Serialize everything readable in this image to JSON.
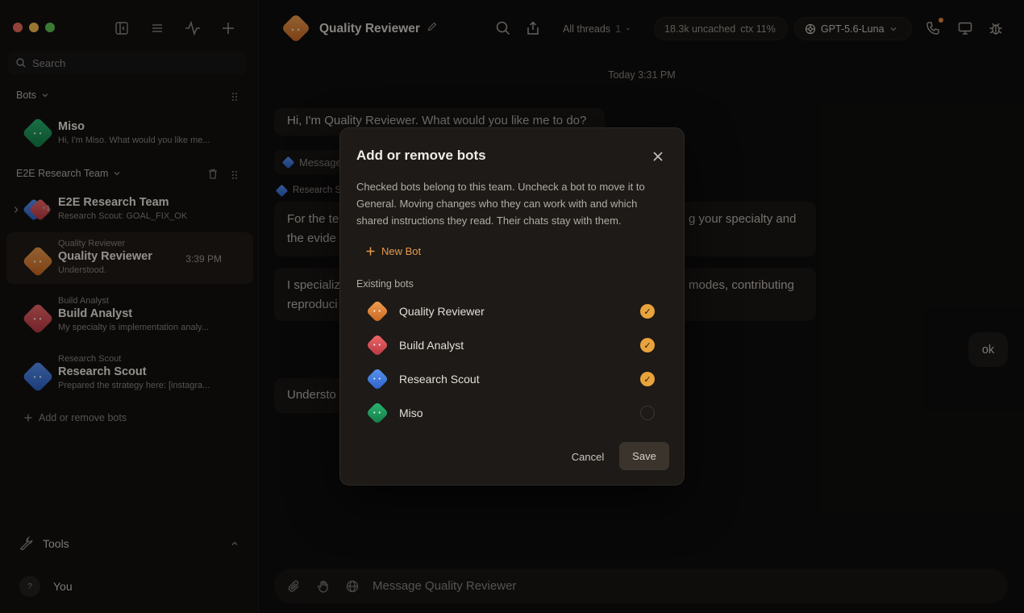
{
  "window": {
    "controls": [
      "close",
      "minimize",
      "zoom"
    ]
  },
  "sidebar": {
    "tool_icons": [
      "sidebar-toggle-icon",
      "list-icon",
      "activity-icon",
      "plus-icon"
    ],
    "search_placeholder": "Search",
    "bots_section": {
      "label": "Bots"
    },
    "bots": [
      {
        "title": "Miso",
        "subtitle": "Hi, I'm Miso. What would you like me...",
        "color": "#1f9a5a"
      }
    ],
    "team_section": {
      "label": "E2E Research Team"
    },
    "team_chats": [
      {
        "kicker": "",
        "title": "E2E Research Team",
        "subtitle": "Research Scout: GOAL_FIX_OK",
        "time": "",
        "badge": "+1",
        "active": false
      },
      {
        "kicker": "Quality Reviewer",
        "title": "Quality Reviewer",
        "subtitle": "Understood.",
        "time": "3:39 PM",
        "active": true,
        "color": "#e08a3a"
      },
      {
        "kicker": "Build Analyst",
        "title": "Build Analyst",
        "subtitle": "My specialty is implementation analy...",
        "time": "",
        "active": false,
        "color": "#d44a55"
      },
      {
        "kicker": "Research Scout",
        "title": "Research Scout",
        "subtitle": "Prepared the strategy here: [instagra...",
        "time": "",
        "active": false,
        "color": "#3f78dc"
      }
    ],
    "add_bots_label": "Add or remove bots",
    "tools_label": "Tools",
    "user": {
      "avatar": "?",
      "name": "You"
    }
  },
  "topbar": {
    "title": "Quality Reviewer",
    "threads_label": "All threads",
    "threads_count": "1",
    "context_label": "18.3k uncached",
    "context_pct": "ctx 11%",
    "model_label": "GPT-5.6-Luna"
  },
  "conversation": {
    "timestamp": "Today 3:31 PM",
    "greeting": "Hi, I'm Quality Reviewer. What would you like me to do?",
    "message_chip": "Message",
    "sender": "Research S",
    "msg1_left": "For the te",
    "msg1_left2": "the evide",
    "msg1_right": "g your specialty and",
    "msg2_left": "I specializ",
    "msg2_left2": "reproduci",
    "msg2_right": "modes, contributing",
    "user_reply": "ok",
    "last_reply": "Understo"
  },
  "composer": {
    "placeholder": "Message Quality Reviewer"
  },
  "modal": {
    "title": "Add or remove bots",
    "description": "Checked bots belong to this team. Uncheck a bot to move it to General. Moving changes who they can work with and which shared instructions they read. Their chats stay with them.",
    "new_bot_label": "New Bot",
    "existing_label": "Existing bots",
    "bots": [
      {
        "name": "Quality Reviewer",
        "checked": true,
        "color": "#e08a3a"
      },
      {
        "name": "Build Analyst",
        "checked": true,
        "color": "#d44a55"
      },
      {
        "name": "Research Scout",
        "checked": true,
        "color": "#3f78dc"
      },
      {
        "name": "Miso",
        "checked": false,
        "color": "#1f9a5a"
      }
    ],
    "cancel_label": "Cancel",
    "save_label": "Save"
  },
  "colors": {
    "accent": "#e9a23c",
    "background": "#0f0e0d",
    "sidebar": "#121110"
  }
}
